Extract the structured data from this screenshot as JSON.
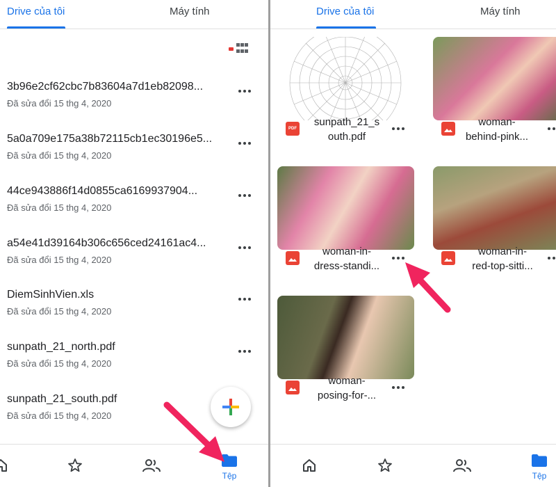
{
  "left": {
    "tabs": [
      {
        "label": "Drive của tôi",
        "active": true
      },
      {
        "label": "Máy tính",
        "active": false
      }
    ],
    "files": [
      {
        "name": "3b96e2cf62cbc7b83604a7d1eb82098...",
        "date": "Đã sửa đổi 15 thg 4, 2020"
      },
      {
        "name": "5a0a709e175a38b72115cb1ec30196e5...",
        "date": "Đã sửa đổi 15 thg 4, 2020"
      },
      {
        "name": "44ce943886f14d0855ca6169937904...",
        "date": "Đã sửa đổi 15 thg 4, 2020"
      },
      {
        "name": "a54e41d39164b306c656ced24161ac4...",
        "date": "Đã sửa đổi 15 thg 4, 2020"
      },
      {
        "name": "DiemSinhVien.xls",
        "date": "Đã sửa đổi 15 thg 4, 2020"
      },
      {
        "name": "sunpath_21_north.pdf",
        "date": "Đã sửa đổi 15 thg 4, 2020"
      },
      {
        "name": "sunpath_21_south.pdf",
        "date": "Đã sửa đổi 15 thg 4, 2020"
      }
    ],
    "nav": [
      {
        "icon": "home-icon"
      },
      {
        "icon": "star-icon"
      },
      {
        "icon": "people-icon"
      },
      {
        "icon": "folder-icon",
        "label": "Tệp",
        "active": true
      }
    ]
  },
  "right": {
    "tabs": [
      {
        "label": "Drive của tôi",
        "active": true
      },
      {
        "label": "Máy tính",
        "active": false
      }
    ],
    "cards": [
      {
        "name_line1": "sunpath_21_s",
        "name_line2": "outh.pdf",
        "type": "pdf",
        "type_label": "PDF"
      },
      {
        "name_line1": "woman-",
        "name_line2": "behind-pink...",
        "type": "image"
      },
      {
        "name_line1": "woman-in-",
        "name_line2": "dress-standi...",
        "type": "image"
      },
      {
        "name_line1": "woman-in-",
        "name_line2": "red-top-sitti...",
        "type": "image"
      },
      {
        "name_line1": "woman-",
        "name_line2": "posing-for-...",
        "type": "image"
      }
    ],
    "nav": [
      {
        "icon": "home-icon"
      },
      {
        "icon": "star-icon"
      },
      {
        "icon": "people-icon"
      },
      {
        "icon": "folder-icon",
        "label": "Tệp",
        "active": true
      }
    ]
  },
  "colors": {
    "accent": "#1a73e8",
    "text": "#202124",
    "secondary_text": "#5f6368",
    "arrow": "#f0245e",
    "file_type_red": "#ea4335"
  }
}
